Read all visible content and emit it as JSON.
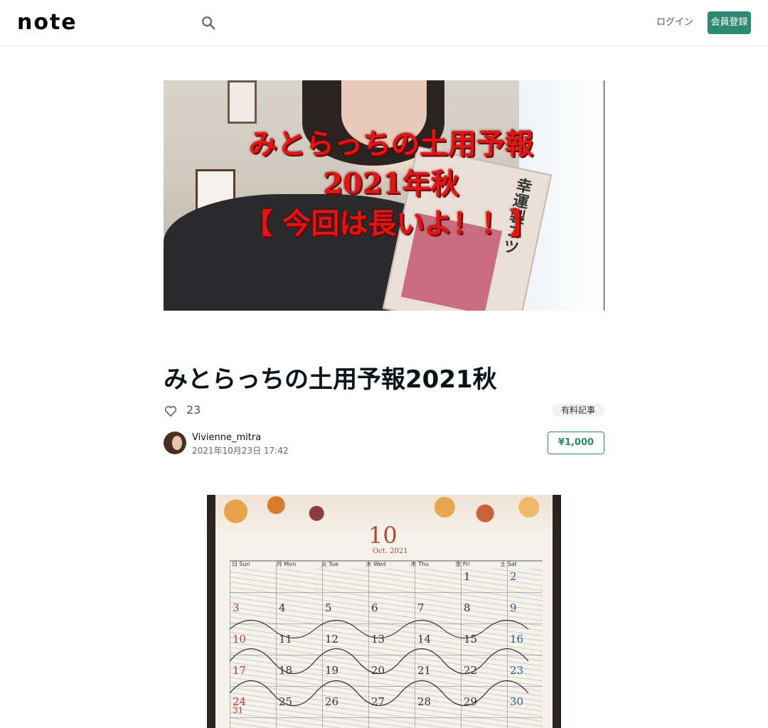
{
  "header": {
    "logo": "note",
    "login_label": "ログイン",
    "signup_label": "会員登録"
  },
  "cover": {
    "title_line1": "みとらっちの土用予報",
    "title_line2": "2021年秋",
    "title_line3": "【 今回は長いよ！！】",
    "book_title": "幸運製コツ"
  },
  "article": {
    "title": "みとらっちの土用予報2021秋",
    "like_count": "23",
    "badge": "有料記事",
    "author_name": "Vivienne_mitra",
    "post_date": "2021年10月23日 17:42",
    "price": "¥1,000"
  },
  "calendar": {
    "month": "10",
    "month_sub": "Oct. 2021",
    "weekdays": [
      "日 Sun",
      "月 Mon",
      "火 Tue",
      "水 Wed",
      "木 Thu",
      "金 Fri",
      "土 Sat"
    ],
    "days": [
      "1",
      "2",
      "3",
      "4",
      "5",
      "6",
      "7",
      "8",
      "9",
      "10",
      "11",
      "12",
      "13",
      "14",
      "15",
      "16",
      "17",
      "18",
      "19",
      "20",
      "21",
      "22",
      "23",
      "24",
      "25",
      "26",
      "27",
      "28",
      "29",
      "30",
      "31"
    ]
  }
}
